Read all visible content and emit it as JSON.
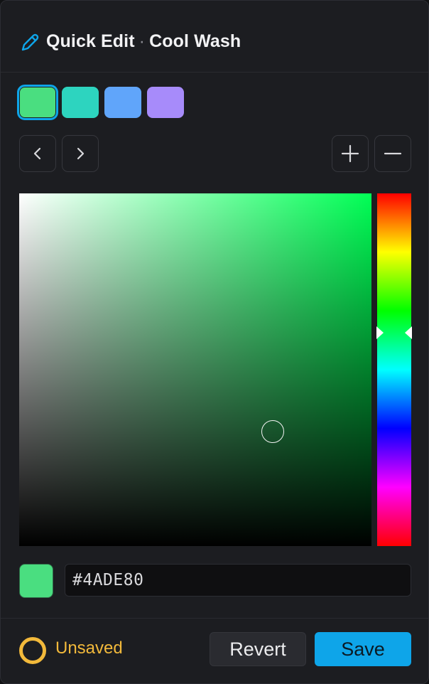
{
  "header": {
    "app_title": "Quick Edit",
    "separator": "·",
    "palette_name": "Cool Wash"
  },
  "swatches": [
    {
      "color": "#4ADE80",
      "selected": true
    },
    {
      "color": "#2DD4BF",
      "selected": false
    },
    {
      "color": "#60A5FA",
      "selected": false
    },
    {
      "color": "#A78BFA",
      "selected": false
    }
  ],
  "nav": {
    "prev_icon": "chevron-left-icon",
    "next_icon": "chevron-right-icon",
    "add_icon": "plus-icon",
    "remove_icon": "minus-icon"
  },
  "picker": {
    "hue": "#00FF55",
    "current_hex": "#4ADE80"
  },
  "footer": {
    "status": "Unsaved",
    "status_color": "#F2B93B",
    "revert_label": "Revert",
    "save_label": "Save",
    "accent_color": "#0EA5E9"
  }
}
